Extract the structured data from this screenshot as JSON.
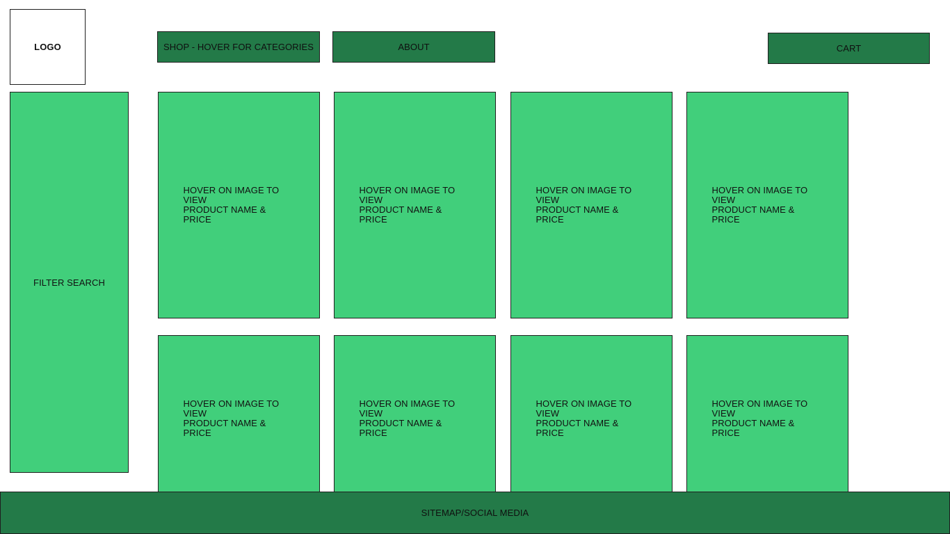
{
  "header": {
    "logo": "LOGO",
    "nav": {
      "shop": "SHOP - HOVER FOR CATEGORIES",
      "about": "ABOUT",
      "cart": "CART"
    }
  },
  "sidebar": {
    "filter": "FILTER SEARCH"
  },
  "products": [
    {
      "line1": "HOVER ON IMAGE TO VIEW",
      "line2": "PRODUCT NAME & PRICE"
    },
    {
      "line1": "HOVER ON IMAGE TO VIEW",
      "line2": "PRODUCT NAME & PRICE"
    },
    {
      "line1": "HOVER ON IMAGE TO VIEW",
      "line2": "PRODUCT NAME & PRICE"
    },
    {
      "line1": "HOVER ON IMAGE TO VIEW",
      "line2": "PRODUCT NAME & PRICE"
    },
    {
      "line1": "HOVER ON IMAGE TO VIEW",
      "line2": "PRODUCT NAME & PRICE"
    },
    {
      "line1": "HOVER ON IMAGE TO VIEW",
      "line2": "PRODUCT NAME & PRICE"
    },
    {
      "line1": "HOVER ON IMAGE TO VIEW",
      "line2": "PRODUCT NAME & PRICE"
    },
    {
      "line1": "HOVER ON IMAGE TO VIEW",
      "line2": "PRODUCT NAME & PRICE"
    }
  ],
  "footer": {
    "text": "SITEMAP/SOCIAL MEDIA"
  },
  "colors": {
    "dark_green": "#237a48",
    "light_green": "#41cf7b",
    "border": "#1f1f1f",
    "background": "#ffffff"
  }
}
